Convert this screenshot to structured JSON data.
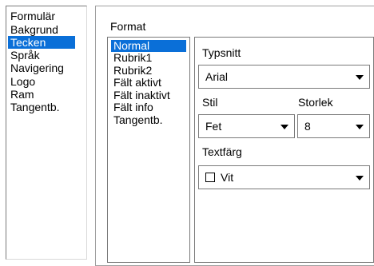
{
  "categories": {
    "items": [
      "Formulär",
      "Bakgrund",
      "Tecken",
      "Språk",
      "Navigering",
      "Logo",
      "Ram",
      "Tangentb."
    ],
    "selected": "Tecken"
  },
  "format": {
    "label": "Format",
    "styles": [
      "Normal",
      "Rubrik1",
      "Rubrik2",
      "Fält aktivt",
      "Fält inaktivt",
      "Fält info",
      "Tangentb."
    ],
    "selected_style": "Normal"
  },
  "properties": {
    "font_label": "Typsnitt",
    "font_value": "Arial",
    "style_label": "Stil",
    "style_value": "Fet",
    "size_label": "Storlek",
    "size_value": "8",
    "color_label": "Textfärg",
    "color_value": "Vit",
    "color_swatch": "#ffffff"
  },
  "colors": {
    "selection": "#0a6fd8"
  }
}
